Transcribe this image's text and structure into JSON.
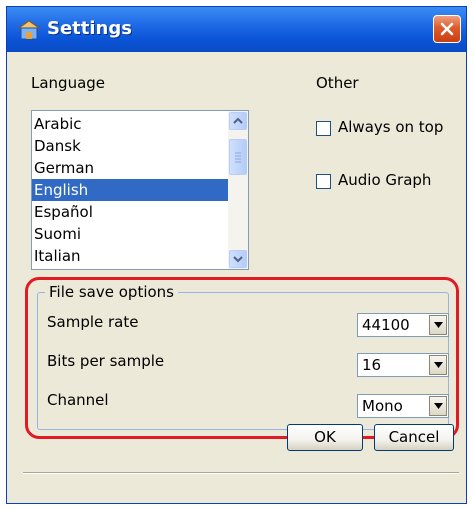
{
  "window": {
    "title": "Settings"
  },
  "language": {
    "heading": "Language",
    "items": [
      "Arabic",
      "Dansk",
      "German",
      "English",
      "Español",
      "Suomi",
      "Italian"
    ],
    "selected": "English"
  },
  "other": {
    "heading": "Other",
    "always_on_top": {
      "label": "Always on top",
      "checked": false
    },
    "audio_graph": {
      "label": "Audio Graph",
      "checked": false
    }
  },
  "file_save_options": {
    "legend": "File save options",
    "sample_rate": {
      "label": "Sample rate",
      "value": "44100"
    },
    "bits_per_sample": {
      "label": "Bits per sample",
      "value": "16"
    },
    "channel": {
      "label": "Channel",
      "value": "Mono"
    }
  },
  "buttons": {
    "ok": "OK",
    "cancel": "Cancel"
  },
  "colors": {
    "title_bar": "#0b55d8",
    "selection": "#316ac5",
    "highlight_outline": "#e01b24",
    "dialog_bg": "#ece9d8"
  },
  "icons": {
    "app": "settings-app-icon",
    "close": "close-icon",
    "dropdown": "chevron-down-icon"
  }
}
